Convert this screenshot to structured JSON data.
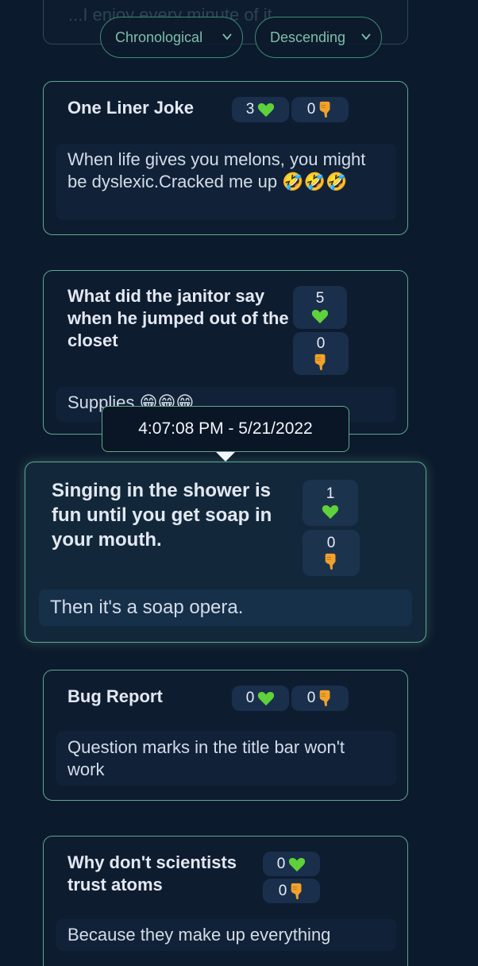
{
  "ghost_text": "...I enjoy every minute of it",
  "sort": {
    "order_label": "Chronological",
    "direction_label": "Descending"
  },
  "tooltip": {
    "timestamp": "4:07:08 PM - 5/21/2022"
  },
  "posts": [
    {
      "title": "One Liner Joke",
      "likes": "3",
      "dislikes": "0",
      "body": "When life gives you melons, you might be dyslexic.Cracked me up 🤣🤣🤣"
    },
    {
      "title": "What did the janitor say when he jumped out of the closet",
      "likes": "5",
      "dislikes": "0",
      "body": "Supplies 😁😁😁"
    },
    {
      "title": "Singing in the shower is fun until you get soap in your mouth.",
      "likes": "1",
      "dislikes": "0",
      "body": "Then it's a soap opera."
    },
    {
      "title": "Bug Report",
      "likes": "0",
      "dislikes": "0",
      "body": "Question marks in the title bar won't work"
    },
    {
      "title": "Why don't scientists trust atoms",
      "likes": "0",
      "dislikes": "0",
      "body": "Because they make up everything"
    }
  ],
  "icons": {
    "like": "green-heart-icon",
    "dislike": "thumbs-down-icon",
    "dropdown": "chevron-down-icon"
  },
  "colors": {
    "background": "#0c1a2d",
    "card_border": "#5ea98c",
    "heart": "#5fd13a",
    "thumb": "#f0a22b"
  }
}
